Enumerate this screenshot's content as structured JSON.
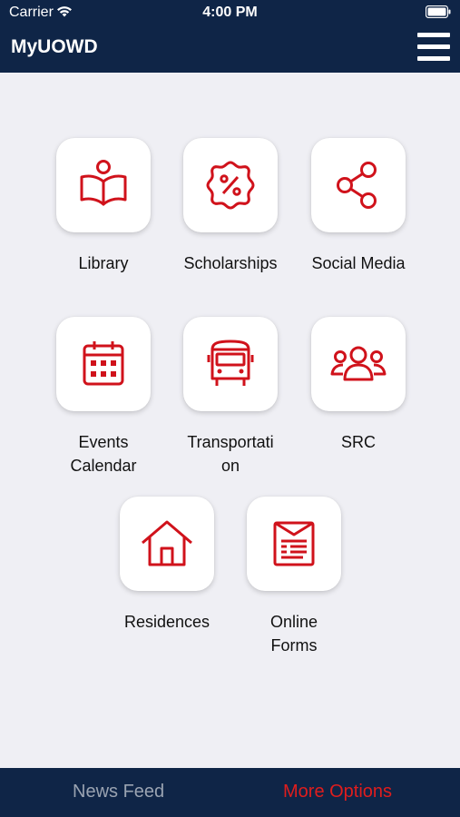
{
  "status_bar": {
    "carrier": "Carrier",
    "time": "4:00 PM",
    "wifi_icon": "wifi-icon",
    "battery_icon": "battery-icon"
  },
  "header": {
    "title": "MyUOWD",
    "menu_icon": "hamburger-menu-icon"
  },
  "tiles": [
    {
      "label": "Library",
      "icon": "book-reader-icon"
    },
    {
      "label": "Scholarships",
      "icon": "percent-badge-icon"
    },
    {
      "label": "Social Media",
      "icon": "share-icon"
    },
    {
      "label": "Events Calendar",
      "icon": "calendar-icon"
    },
    {
      "label": "Transportation",
      "icon": "bus-icon"
    },
    {
      "label": "SRC",
      "icon": "group-icon"
    },
    {
      "label": "Residences",
      "icon": "house-icon"
    },
    {
      "label": "Online Forms",
      "icon": "form-icon"
    }
  ],
  "tab_bar": {
    "news_feed": "News Feed",
    "more_options": "More Options"
  },
  "colors": {
    "navy": "#0f2547",
    "accent_red": "#d0121b",
    "background": "#efeff4",
    "inactive_tab": "#9aa3b1",
    "active_tab": "#e01d1d"
  }
}
